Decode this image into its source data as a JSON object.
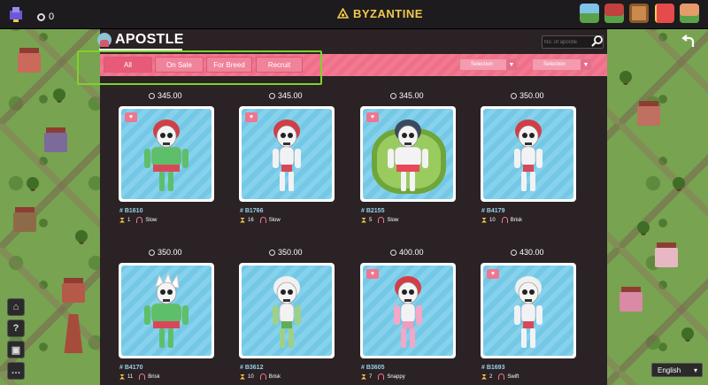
{
  "topbar": {
    "coin_balance": "0",
    "brand": "BYZANTINE",
    "icons": [
      "map-icon",
      "gift-box-icon",
      "crate-icon",
      "present-icon",
      "profile-icon"
    ]
  },
  "panel": {
    "title": "APOSTLE",
    "search_placeholder": "No. of apostle",
    "tabs": [
      {
        "label": "All",
        "active": true
      },
      {
        "label": "On Sale",
        "active": false
      },
      {
        "label": "For Breed",
        "active": false
      },
      {
        "label": "Recruit",
        "active": false
      }
    ],
    "selects": [
      {
        "label": "Selection"
      },
      {
        "label": "Selection"
      }
    ]
  },
  "cards": [
    {
      "price": "345.00",
      "id": "# B1610",
      "gen": "1",
      "speed": "Slow",
      "heart": true,
      "style": "muscle",
      "hair": "#d23e45"
    },
    {
      "price": "345.00",
      "id": "# B1766",
      "gen": "16",
      "speed": "Slow",
      "heart": true,
      "style": "slim",
      "hair": "#d23e45"
    },
    {
      "price": "345.00",
      "id": "# B2155",
      "gen": "5",
      "speed": "Slow",
      "heart": true,
      "style": "bush",
      "hair": "#3b4a5c"
    },
    {
      "price": "350.00",
      "id": "# B4179",
      "gen": "10",
      "speed": "Brisk",
      "heart": false,
      "style": "slim",
      "hair": "#d23e45"
    },
    {
      "price": "350.00",
      "id": "# B4170",
      "gen": "11",
      "speed": "Brisk",
      "heart": false,
      "style": "muscle",
      "hair": "#ffffff"
    },
    {
      "price": "350.00",
      "id": "# B3612",
      "gen": "10",
      "speed": "Brisk",
      "heart": false,
      "style": "slim-green",
      "hair": "#f0f0f0"
    },
    {
      "price": "400.00",
      "id": "# B3605",
      "gen": "7",
      "speed": "Snappy",
      "heart": true,
      "style": "slim-pink",
      "hair": "#d23e45"
    },
    {
      "price": "430.00",
      "id": "# B1693",
      "gen": "2",
      "speed": "Swift",
      "heart": true,
      "style": "slim",
      "hair": "#f0f0f0"
    }
  ],
  "language": "English",
  "colors": {
    "accent_pink": "#ef7690",
    "brand_gold": "#f2c94c",
    "highlight_green": "#7fd22b"
  }
}
